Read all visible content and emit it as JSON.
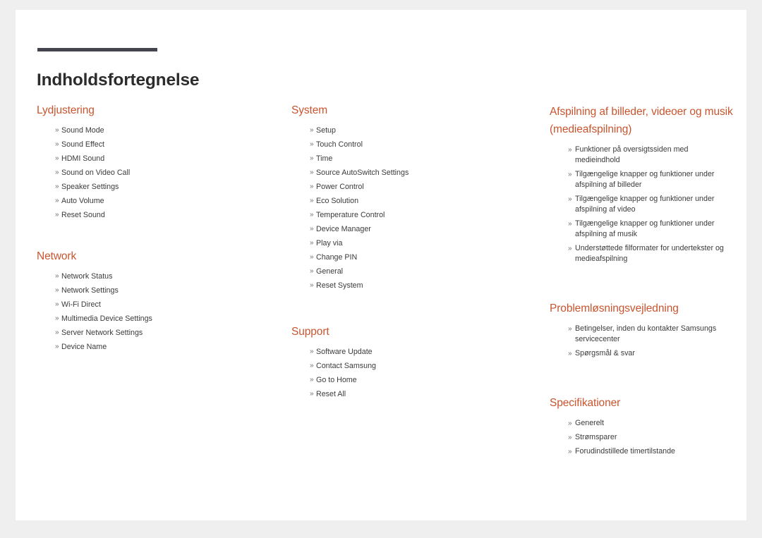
{
  "document": {
    "title": "Indholdsfortegnelse",
    "accent_color": "#c8552f",
    "rule_color": "#44444e",
    "title_color": "#2c2c2c",
    "page_background": "#ffffff",
    "canvas_background": "#efefef",
    "bullet_marker": "»"
  },
  "columns": [
    {
      "id": "column-left",
      "sections": [
        {
          "heading": "Lydjustering",
          "items": [
            "Sound Mode",
            "Sound Effect",
            "HDMI Sound",
            "Sound on Video Call",
            "Speaker Settings",
            "Auto Volume",
            "Reset Sound"
          ]
        },
        {
          "heading": "Network",
          "items": [
            "Network Status",
            "Network Settings",
            "Wi-Fi Direct",
            "Multimedia Device Settings",
            "Server Network Settings",
            "Device Name"
          ]
        }
      ]
    },
    {
      "id": "column-middle",
      "sections": [
        {
          "heading": "System",
          "items": [
            "Setup",
            "Touch Control",
            "Time",
            "Source AutoSwitch Settings",
            "Power Control",
            "Eco Solution",
            "Temperature Control",
            "Device Manager",
            "Play via",
            "Change PIN",
            "General",
            "Reset System"
          ]
        },
        {
          "heading": "Support",
          "items": [
            "Software Update",
            "Contact Samsung",
            "Go to Home",
            "Reset All"
          ]
        }
      ]
    },
    {
      "id": "column-right",
      "sections": [
        {
          "heading": "Afspilning af billeder, videoer og musik (medieafspilning)",
          "items": [
            "Funktioner på oversigtssiden med medieindhold",
            "Tilgængelige knapper og funktioner under afspilning af billeder",
            "Tilgængelige knapper og funktioner under afspilning af video",
            "Tilgængelige knapper og funktioner under afspilning af musik",
            "Understøttede filformater for undertekster og medieafspilning"
          ]
        },
        {
          "heading": "Problemløsningsvejledning",
          "items": [
            "Betingelser, inden du kontakter Samsungs servicecenter",
            "Spørgsmål & svar"
          ]
        },
        {
          "heading": "Specifikationer",
          "items": [
            "Generelt",
            "Strømsparer",
            "Forudindstillede timertilstande"
          ]
        }
      ]
    }
  ]
}
